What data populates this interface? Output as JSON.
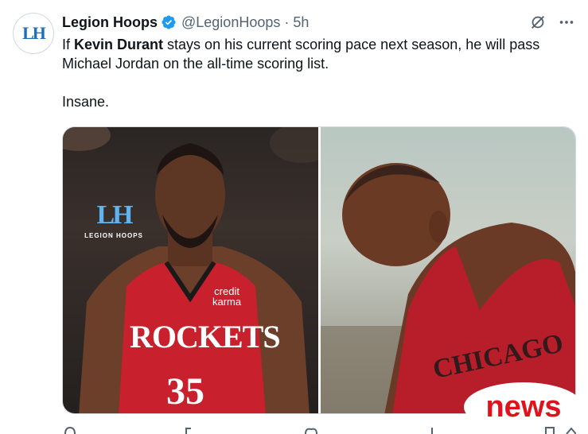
{
  "account": {
    "display_name": "Legion Hoops",
    "handle": "@LegionHoops",
    "separator": "·",
    "time": "5h",
    "avatar_text": "LH"
  },
  "tweet": {
    "line1_prefix": "If ",
    "line1_mention": "Kevin Durant",
    "line1_suffix": " stays on his current scoring pace next season, he will pass Michael Jordan on the all-time scoring list.",
    "line2": "Insane."
  },
  "media": {
    "left_photo": {
      "watermark_mark": "LH",
      "watermark_text": "LEGION HOOPS",
      "jersey_word": "ROCKETS",
      "jersey_number": "35",
      "sponsor_line1": "credit",
      "sponsor_line2": "karma"
    },
    "right_photo": {
      "jersey_word": "CHICAGO"
    }
  },
  "overlay": {
    "news_text": "news",
    "news_color": "#e0121b"
  },
  "icons": {
    "verified": "verified-badge-icon",
    "grok": "grok-icon",
    "more": "more-icon"
  },
  "colors": {
    "accent": "#1d9bf0",
    "muted": "#536471",
    "text": "#0f1419"
  }
}
